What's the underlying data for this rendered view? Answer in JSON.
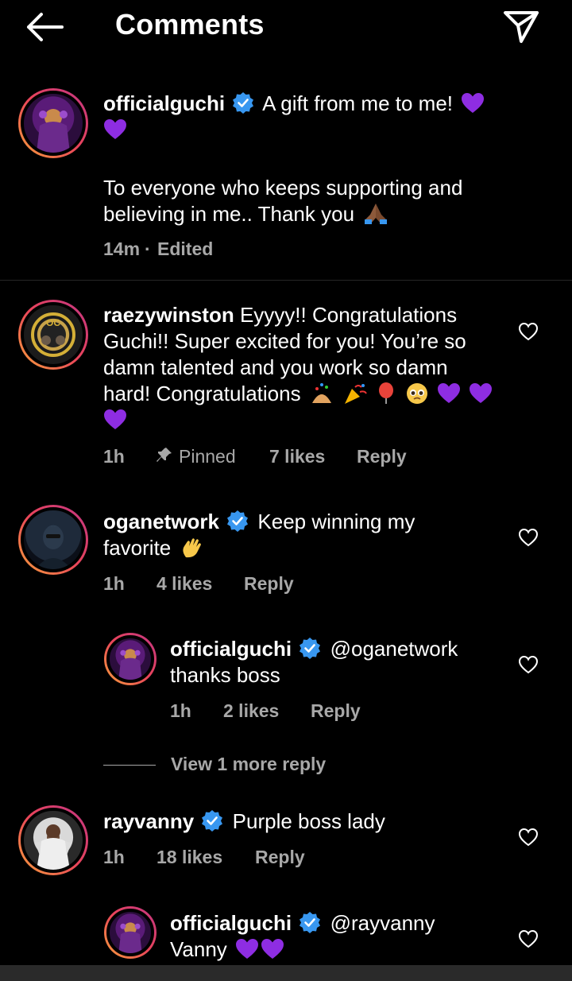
{
  "header": {
    "title": "Comments"
  },
  "caption": {
    "username": "officialguchi",
    "text_line1": "A gift from me to me!",
    "text_line2": "To everyone who keeps supporting and",
    "text_line3": "believing in me.. Thank you",
    "time": "14m",
    "separator": "·",
    "edited": "Edited"
  },
  "comments": [
    {
      "username": "raezywinston",
      "line1": "Eyyyy!! Congratulations",
      "line2": "Guchi!! Super excited for you! You’re so",
      "line3": "damn talented and you work so damn",
      "line4": "hard! Congratulations",
      "time": "1h",
      "pinned": "Pinned",
      "likes": "7 likes",
      "reply": "Reply"
    },
    {
      "username": "oganetwork",
      "line1": "Keep winning my",
      "line2": "favorite",
      "time": "1h",
      "likes": "4 likes",
      "reply": "Reply"
    },
    {
      "username": "officialguchi",
      "line1": "@oganetwork",
      "line2": "thanks boss",
      "time": "1h",
      "likes": "2 likes",
      "reply": "Reply"
    },
    {
      "username": "rayvanny",
      "line1": "Purple boss lady",
      "time": "1h",
      "likes": "18 likes",
      "reply": "Reply"
    },
    {
      "username": "officialguchi",
      "line1": "@rayvanny",
      "line2": "Vanny"
    }
  ],
  "view_more": "View 1 more reply",
  "colors": {
    "background": "#000000",
    "secondary_text": "#a8a8a8",
    "verified_blue": "#3897f0",
    "heart_purple": "#8e2de2"
  }
}
